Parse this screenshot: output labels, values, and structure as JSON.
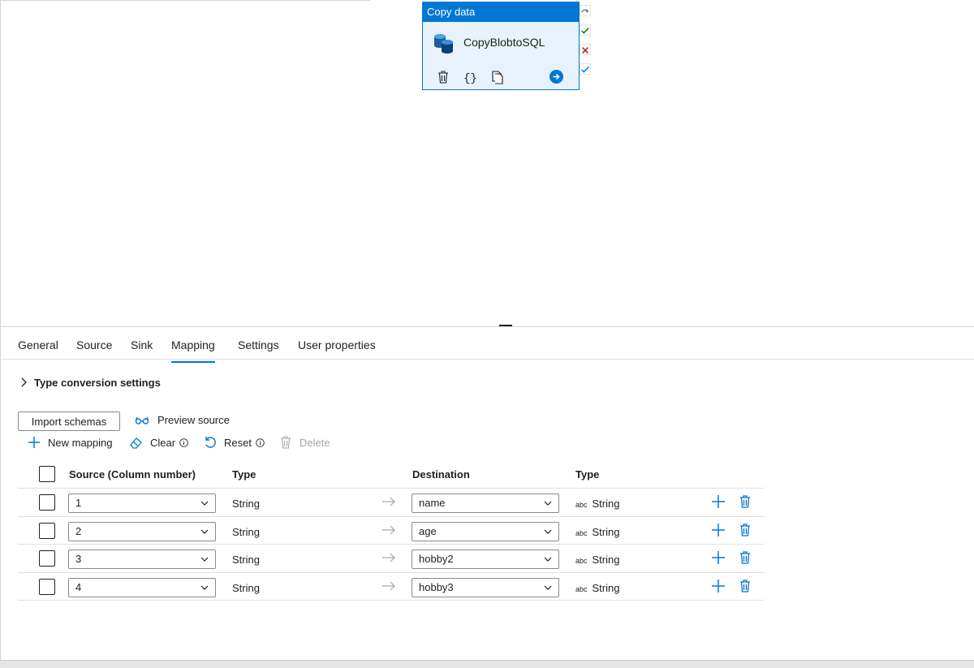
{
  "activity": {
    "header": "Copy data",
    "name": "CopyBlobtoSQL",
    "tools": [
      "delete-icon",
      "code-icon",
      "copy-icon"
    ],
    "run_icon": "arrow-right-circle-icon"
  },
  "ports": [
    "skip-port-icon",
    "success-port-icon",
    "failure-port-icon",
    "completion-port-icon"
  ],
  "tabs": [
    {
      "label": "General",
      "active": false
    },
    {
      "label": "Source",
      "active": false
    },
    {
      "label": "Sink",
      "active": false
    },
    {
      "label": "Mapping",
      "active": true
    },
    {
      "label": "Settings",
      "active": false
    },
    {
      "label": "User properties",
      "active": false
    }
  ],
  "type_conversion": {
    "label": "Type conversion settings",
    "expanded": false
  },
  "import_schemas_label": "Import schemas",
  "preview_source_label": "Preview source",
  "commands": {
    "new_mapping": "New mapping",
    "clear": "Clear",
    "reset": "Reset",
    "delete": "Delete"
  },
  "table": {
    "headers": {
      "source": "Source (Column number)",
      "type": "Type",
      "destination": "Destination",
      "dest_type": "Type"
    },
    "rows": [
      {
        "source": "1",
        "type": "String",
        "destination": "name",
        "dest_type_prefix": "abc",
        "dest_type": "String"
      },
      {
        "source": "2",
        "type": "String",
        "destination": "age",
        "dest_type_prefix": "abc",
        "dest_type": "String"
      },
      {
        "source": "3",
        "type": "String",
        "destination": "hobby2",
        "dest_type_prefix": "abc",
        "dest_type": "String"
      },
      {
        "source": "4",
        "type": "String",
        "destination": "hobby3",
        "dest_type_prefix": "abc",
        "dest_type": "String"
      }
    ]
  },
  "colors": {
    "accent": "#0078d4",
    "success": "#107c10",
    "failure": "#a4262c"
  }
}
